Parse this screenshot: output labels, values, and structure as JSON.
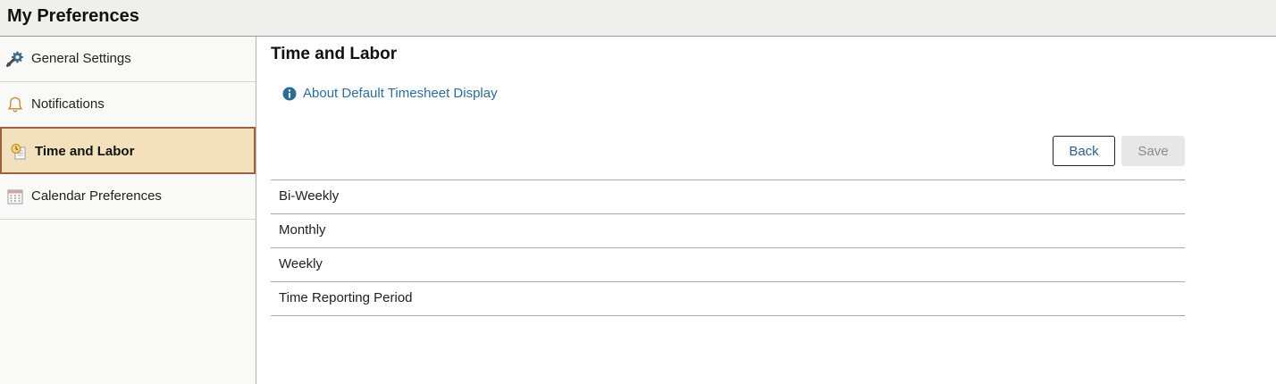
{
  "header": {
    "title": "My Preferences"
  },
  "sidebar": {
    "items": [
      {
        "label": "General Settings",
        "icon": "wrench-gear-icon"
      },
      {
        "label": "Notifications",
        "icon": "bell-icon"
      },
      {
        "label": "Time and Labor",
        "icon": "timesheet-clock-icon",
        "active": true
      },
      {
        "label": "Calendar Preferences",
        "icon": "calendar-icon"
      }
    ]
  },
  "main": {
    "title": "Time and Labor",
    "info_link": "About Default Timesheet Display",
    "back_label": "Back",
    "save_label": "Save",
    "list": [
      "Bi-Weekly",
      "Monthly",
      "Weekly",
      "Time Reporting Period"
    ]
  },
  "colors": {
    "active_bg": "#f3e1be",
    "active_border": "#a0603f",
    "link": "#2d6e9a",
    "info_icon": "#2c6b93"
  }
}
